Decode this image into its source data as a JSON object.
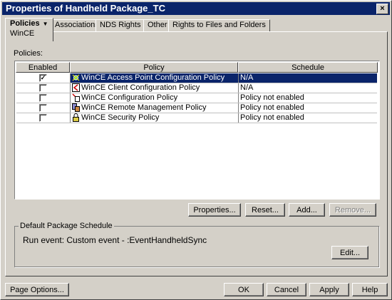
{
  "window": {
    "title": "Properties of Handheld Package_TC",
    "close_glyph": "×"
  },
  "tabs": [
    {
      "label": "Policies",
      "sub": "WinCE",
      "active": true,
      "dropdown": true
    },
    {
      "label": "Associations"
    },
    {
      "label": "NDS Rights",
      "dropdown": true
    },
    {
      "label": "Other"
    },
    {
      "label": "Rights to Files and Folders"
    }
  ],
  "policies_label": "Policies:",
  "table": {
    "headers": [
      "Enabled",
      "Policy",
      "Schedule"
    ],
    "rows": [
      {
        "enabled": true,
        "icon": "access-point-policy-icon",
        "policy": "WinCE Access Point Configuration Policy",
        "schedule": "N/A",
        "selected": true
      },
      {
        "enabled": false,
        "icon": "client-config-policy-icon",
        "policy": "WinCE Client Configuration Policy",
        "schedule": "N/A"
      },
      {
        "enabled": false,
        "icon": "config-policy-icon",
        "policy": "WinCE Configuration Policy",
        "schedule": "Policy not enabled"
      },
      {
        "enabled": false,
        "icon": "remote-management-policy-icon",
        "policy": "WinCE Remote Management Policy",
        "schedule": "Policy not enabled"
      },
      {
        "enabled": false,
        "icon": "security-policy-icon",
        "policy": "WinCE Security Policy",
        "schedule": "Policy not enabled"
      }
    ]
  },
  "buttons": {
    "properties": "Properties...",
    "reset": "Reset...",
    "add": "Add...",
    "remove": "Remove..."
  },
  "default_schedule": {
    "title": "Default Package Schedule",
    "text": "Run event: Custom event - :EventHandheldSync",
    "edit": "Edit..."
  },
  "footer": {
    "page_options": "Page Options...",
    "ok": "OK",
    "cancel": "Cancel",
    "apply": "Apply",
    "help": "Help"
  },
  "colors": {
    "titlebar": "#0a246a",
    "selection": "#0a246a",
    "face": "#d4d0c8"
  }
}
